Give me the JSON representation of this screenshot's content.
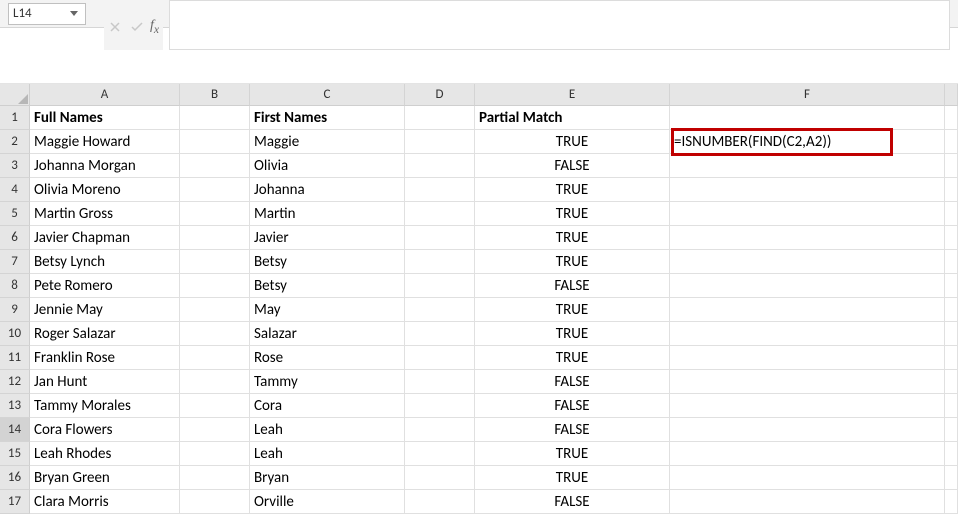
{
  "name_box": "L14",
  "formula_input": "",
  "columns": [
    "A",
    "B",
    "C",
    "D",
    "E",
    "F"
  ],
  "headers": {
    "A": "Full Names",
    "C": "First Names",
    "E": "Partial Match"
  },
  "callout_formula": "=ISNUMBER(FIND(C2,A2))",
  "rows": [
    {
      "n": 1
    },
    {
      "n": 2,
      "A": "Maggie Howard",
      "C": "Maggie",
      "E": "TRUE"
    },
    {
      "n": 3,
      "A": "Johanna Morgan",
      "C": "Olivia",
      "E": "FALSE"
    },
    {
      "n": 4,
      "A": "Olivia Moreno",
      "C": "Johanna",
      "E": "TRUE"
    },
    {
      "n": 5,
      "A": "Martin Gross",
      "C": "Martin",
      "E": "TRUE"
    },
    {
      "n": 6,
      "A": "Javier Chapman",
      "C": "Javier",
      "E": "TRUE"
    },
    {
      "n": 7,
      "A": "Betsy Lynch",
      "C": "Betsy",
      "E": "TRUE"
    },
    {
      "n": 8,
      "A": "Pete Romero",
      "C": "Betsy",
      "E": "FALSE"
    },
    {
      "n": 9,
      "A": "Jennie May",
      "C": "May",
      "E": "TRUE"
    },
    {
      "n": 10,
      "A": "Roger Salazar",
      "C": "Salazar",
      "E": "TRUE"
    },
    {
      "n": 11,
      "A": "Franklin Rose",
      "C": "Rose",
      "E": "TRUE"
    },
    {
      "n": 12,
      "A": "Jan Hunt",
      "C": "Tammy",
      "E": "FALSE"
    },
    {
      "n": 13,
      "A": "Tammy Morales",
      "C": "Cora",
      "E": "FALSE"
    },
    {
      "n": 14,
      "A": "Cora Flowers",
      "C": "Leah",
      "E": "FALSE"
    },
    {
      "n": 15,
      "A": "Leah Rhodes",
      "C": "Leah",
      "E": "TRUE"
    },
    {
      "n": 16,
      "A": "Bryan Green",
      "C": "Bryan",
      "E": "TRUE"
    },
    {
      "n": 17,
      "A": "Clara Morris",
      "C": "Orville",
      "E": "FALSE"
    }
  ]
}
